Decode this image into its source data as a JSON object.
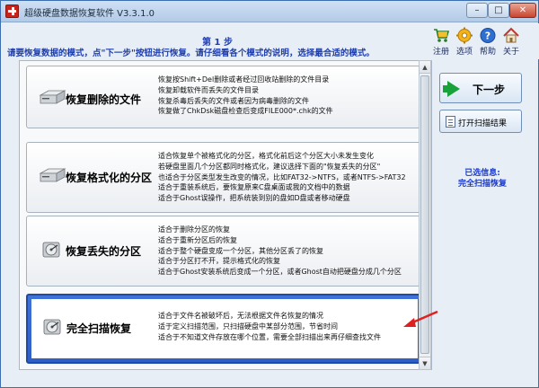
{
  "window": {
    "title": "超级硬盘数据恢复软件 V3.3.1.0",
    "minimize_label": "–",
    "maximize_label": "□",
    "close_label": "✕"
  },
  "header": {
    "step_title": "第 1 步",
    "instruction": "请要恢复数据的模式，点\"下一步\"按钮进行恢复。请仔细看各个模式的说明，选择最合适的模式。"
  },
  "toolbar": [
    {
      "label": "注册",
      "icon": "cart-icon"
    },
    {
      "label": "选项",
      "icon": "gear-icon"
    },
    {
      "label": "帮助",
      "icon": "help-icon"
    },
    {
      "label": "关于",
      "icon": "home-icon"
    }
  ],
  "modes": [
    {
      "name": "恢复删除的文件",
      "lines": [
        "恢复按Shift+Del删除或者经过回收站删除的文件目录",
        "恢复卸载软件而丢失的文件目录",
        "恢复杀毒后丢失的文件或者因为病毒删除的文件",
        "恢复做了ChkDsk磁盘检查后变成FILE000*.chk的文件"
      ],
      "selected": false
    },
    {
      "name": "恢复格式化的分区",
      "lines": [
        "适合恢复单个被格式化的分区，格式化前后这个分区大小未发生变化",
        "若硬盘里面几个分区都同时格式化，建议选择下面的\"恢复丢失的分区\"",
        "也适合于分区类型发生改变的情况，比如FAT32->NTFS，或者NTFS->FAT32",
        "适合于重装系统后，要恢复原来C盘桌面或我的文档中的数据",
        "适合于Ghost误操作，把系统装到别的盘如D盘或者移动硬盘"
      ],
      "selected": false
    },
    {
      "name": "恢复丢失的分区",
      "lines": [
        "适合于删除分区的恢复",
        "适合于重新分区后的恢复",
        "适合于整个硬盘变成一个分区，其他分区丢了的恢复",
        "适合于分区打不开，提示格式化的恢复",
        "适合于Ghost安装系统后变成一个分区，或者Ghost自动把硬盘分成几个分区"
      ],
      "selected": false
    },
    {
      "name": "完全扫描恢复",
      "lines": [
        "适合于文件名被破坏后，无法根据文件名恢复的情况",
        "适于定义扫描范围，只扫描硬盘中某部分范围，节省时间",
        "适合于不知道文件存放在哪个位置，需要全部扫描出来再仔细查找文件"
      ],
      "selected": true
    }
  ],
  "actions": {
    "next_label": "下一步",
    "open_scan_label": "打开扫描结果"
  },
  "selected_info": {
    "label": "已选信息:",
    "value": "完全扫描恢复"
  },
  "colors": {
    "accent_blue": "#1f3fae",
    "selected_border": "#2d5fc6",
    "annotation_red": "#e02020",
    "next_arrow_green": "#18a33a"
  }
}
